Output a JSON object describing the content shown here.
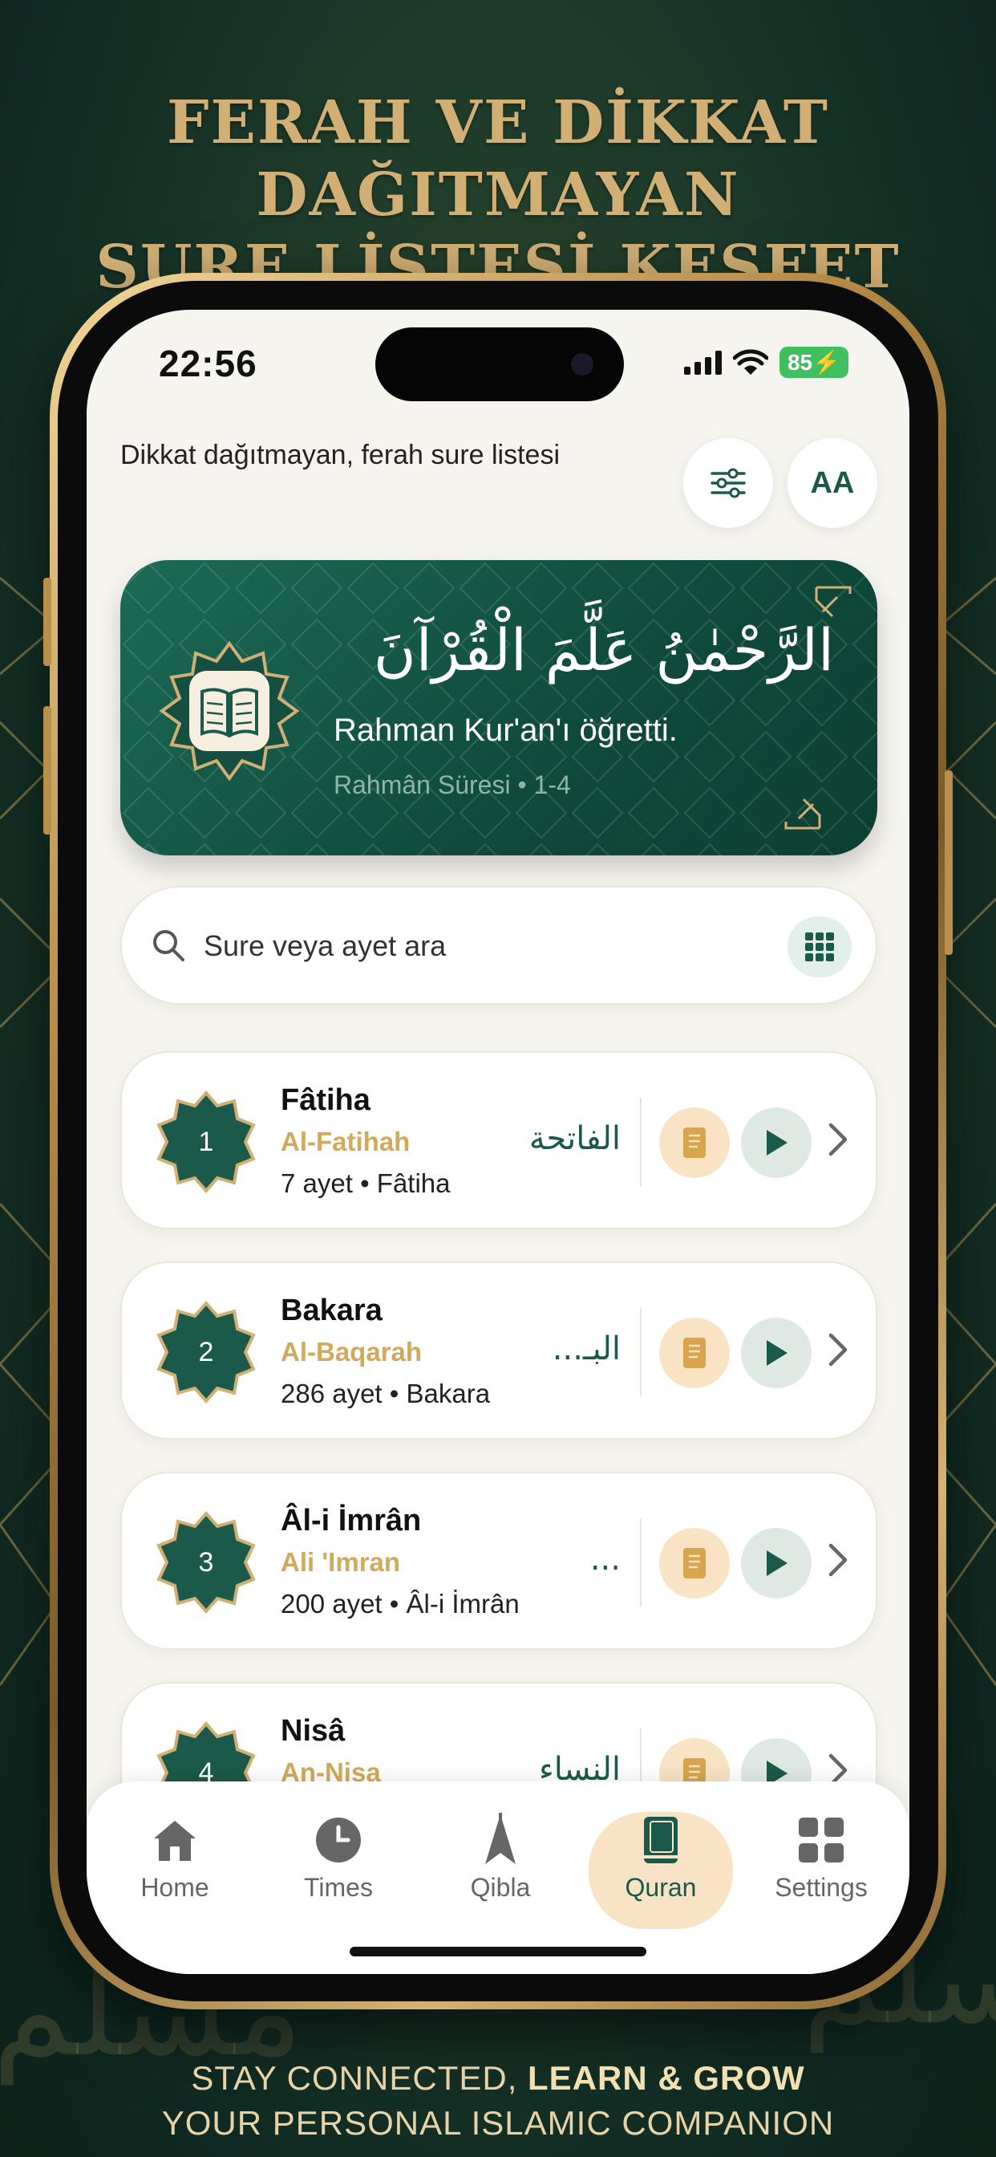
{
  "headline": {
    "line1": "FERAH VE DİKKAT DAĞITMAYAN",
    "line2": "SURE LİSTESİ KEŞFET"
  },
  "footer": {
    "line1_regular": "STAY CONNECTED, ",
    "line1_bold": "LEARN & GROW",
    "line2": "YOUR PERSONAL ISLAMIC COMPANION"
  },
  "status_bar": {
    "time": "22:56",
    "battery": "85"
  },
  "header": {
    "subtitle": "Dikkat dağıtmayan, ferah sure listesi",
    "font_button_label": "AA"
  },
  "verse_card": {
    "arabic": "الرَّحْمٰنُ عَلَّمَ الْقُرْآنَ",
    "translation": "Rahman Kur'an'ı öğretti.",
    "reference": "Rahmân Süresi • 1-4"
  },
  "search": {
    "placeholder": "Sure veya ayet ara"
  },
  "suras": [
    {
      "number": "1",
      "name": "Fâtiha",
      "latin": "Al-Fatihah",
      "meta": "7 ayet • Fâtiha",
      "arabic": "الفاتحة"
    },
    {
      "number": "2",
      "name": "Bakara",
      "latin": "Al-Baqarah",
      "meta": "286 ayet • Bakara",
      "arabic": "البـ..."
    },
    {
      "number": "3",
      "name": "Âl-i İmrân",
      "latin": "Ali 'Imran",
      "meta": "200 ayet • Âl-i İmrân",
      "arabic": "..."
    },
    {
      "number": "4",
      "name": "Nisâ",
      "latin": "An-Nisa",
      "meta": "",
      "arabic": "النساء"
    }
  ],
  "tabs": [
    {
      "label": "Home",
      "icon": "home-icon",
      "active": false
    },
    {
      "label": "Times",
      "icon": "clock-icon",
      "active": false
    },
    {
      "label": "Qibla",
      "icon": "qibla-compass-icon",
      "active": false
    },
    {
      "label": "Quran",
      "icon": "book-icon",
      "active": true
    },
    {
      "label": "Settings",
      "icon": "grid-icon",
      "active": false
    }
  ],
  "colors": {
    "primary_green": "#1b5a4a",
    "gold": "#d2a95b",
    "active_tab_bg": "#f8e4c4",
    "screen_bg": "#f6f4ee"
  }
}
